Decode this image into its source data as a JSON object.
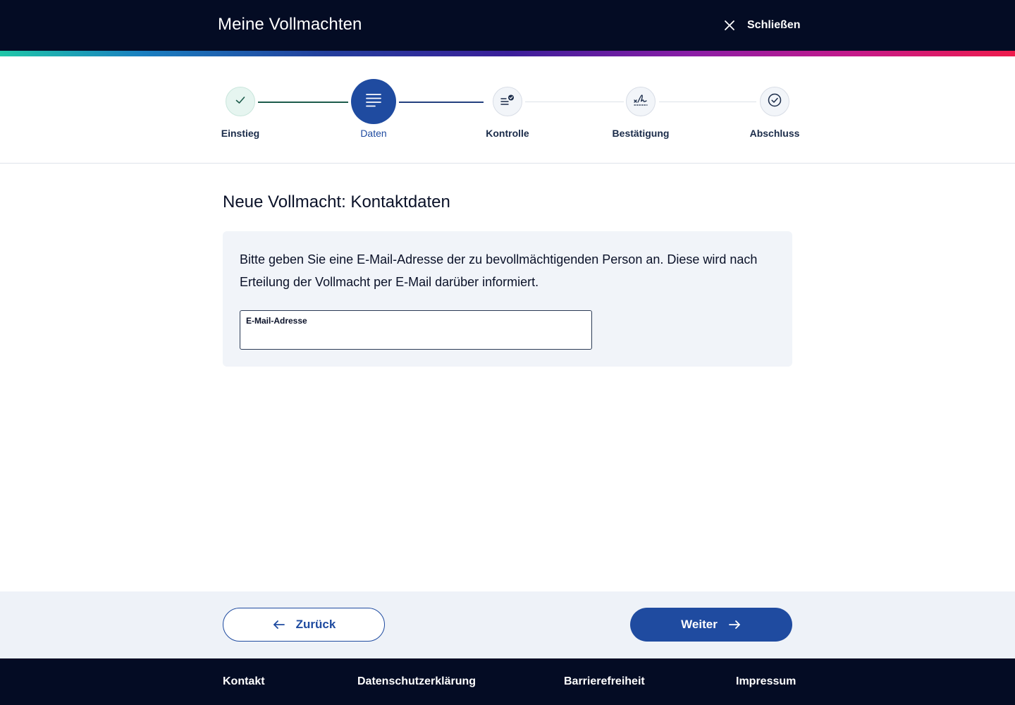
{
  "header": {
    "title": "Meine Vollmachten",
    "close_label": "Schließen"
  },
  "stepper": {
    "steps": [
      {
        "label": "Einstieg",
        "state": "done",
        "icon": "check-icon"
      },
      {
        "label": "Daten",
        "state": "active",
        "icon": "document-lines-icon"
      },
      {
        "label": "Kontrolle",
        "state": "pending",
        "icon": "list-check-icon"
      },
      {
        "label": "Bestätigung",
        "state": "pending",
        "icon": "signature-icon"
      },
      {
        "label": "Abschluss",
        "state": "pending",
        "icon": "check-circle-icon"
      }
    ]
  },
  "main": {
    "title": "Neue Vollmacht: Kontaktdaten",
    "info_text": "Bitte geben Sie eine E-Mail-Adresse der zu bevollmächtigenden Person an. Diese wird nach Erteilung der Vollmacht per E-Mail darüber informiert.",
    "email_field": {
      "label": "E-Mail-Adresse",
      "value": ""
    }
  },
  "actions": {
    "back_label": "Zurück",
    "next_label": "Weiter"
  },
  "footer": {
    "links": [
      "Kontakt",
      "Datenschutzerklärung",
      "Barrierefreiheit",
      "Impressum"
    ]
  },
  "colors": {
    "header_bg": "#040c24",
    "primary": "#1f4ba0",
    "card_bg": "#f1f4f9",
    "done_step": "#1c5b4b"
  }
}
